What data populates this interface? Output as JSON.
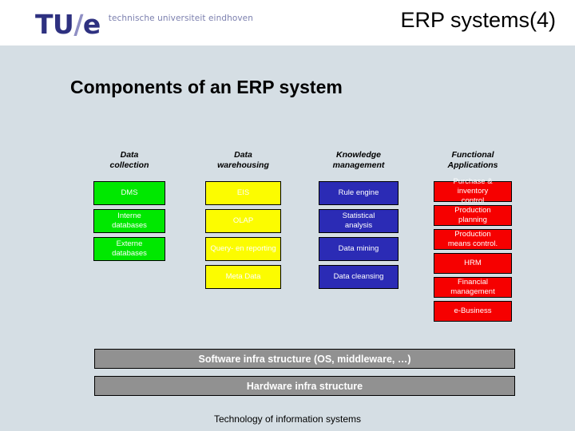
{
  "header": {
    "logo_tu": "TU",
    "logo_slash": "/",
    "logo_e": "e",
    "logo_tagline": "technische universiteit eindhoven",
    "slide_title": "ERP systems(4)"
  },
  "page_heading": "Components of an ERP system",
  "columns": [
    {
      "header": "Data\ncollection",
      "color": "#00e800",
      "boxes": [
        "DMS",
        "Interne\ndatabases",
        "Externe\ndatabases"
      ]
    },
    {
      "header": "Data\nwarehousing",
      "color": "#fcfc00",
      "boxes": [
        "EIS",
        "OLAP",
        "Query- en reporting",
        "Meta Data"
      ]
    },
    {
      "header": "Knowledge\nmanagement",
      "color": "#2b2bb5",
      "boxes": [
        "Rule engine",
        "Statistical\nanalysis",
        "Data mining",
        "Data cleansing"
      ]
    },
    {
      "header": "Functional\nApplications",
      "color": "#f60000",
      "boxes": [
        "Purchase &\ninventory\ncontrol",
        "Production\nplanning",
        "Production\nmeans control.",
        "HRM",
        "Financial\nmanagement",
        "e-Business"
      ]
    }
  ],
  "infrastructure": {
    "software": "Software infra structure (OS, middleware, …)",
    "hardware": "Hardware infra structure",
    "bar_color": "#919191"
  },
  "caption": "Technology of  information systems",
  "background_color": "#d5dee4"
}
